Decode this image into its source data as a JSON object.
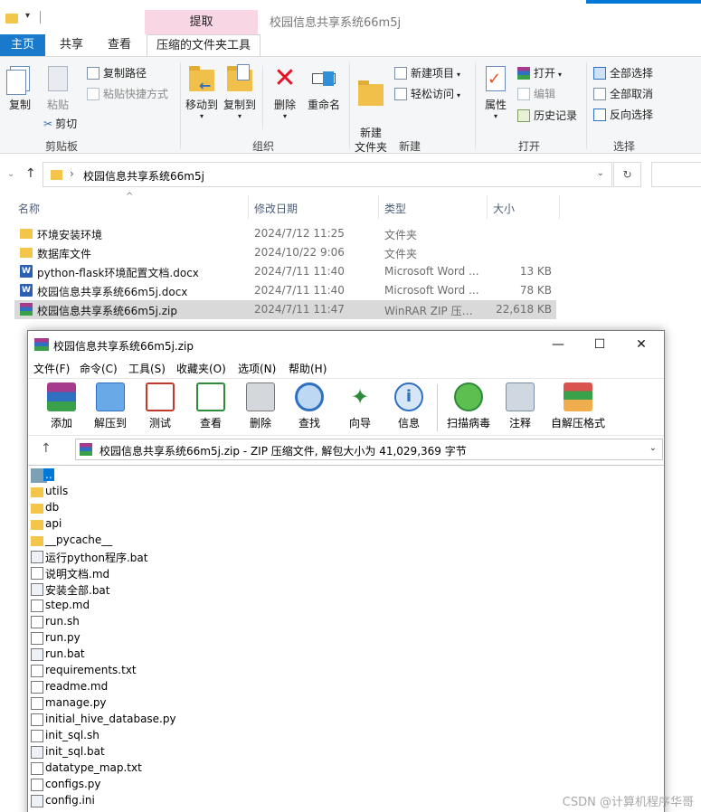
{
  "window": {
    "title": "校园信息共享系统66m5j",
    "context_tab": "提取"
  },
  "ribbon_tabs": [
    "主页",
    "共享",
    "查看",
    "压缩的文件夹工具"
  ],
  "ribbon": {
    "clipboard": {
      "copy": "复制",
      "paste": "粘贴",
      "copy_path": "复制路径",
      "paste_shortcut": "粘贴快捷方式",
      "cut": "剪切",
      "label": "剪贴板"
    },
    "organize": {
      "move_to": "移动到",
      "copy_to": "复制到",
      "delete": "删除",
      "rename": "重命名",
      "label": "组织"
    },
    "new": {
      "new_folder": "新建\n文件夹",
      "new_item": "新建项目",
      "easy_access": "轻松访问",
      "label": "新建"
    },
    "open": {
      "properties": "属性",
      "open": "打开",
      "edit": "编辑",
      "history": "历史记录",
      "label": "打开"
    },
    "select": {
      "select_all": "全部选择",
      "select_none": "全部取消",
      "invert": "反向选择",
      "label": "选择"
    }
  },
  "address": {
    "path": "校园信息共享系统66m5j"
  },
  "columns": {
    "name": "名称",
    "date": "修改日期",
    "type": "类型",
    "size": "大小"
  },
  "files": [
    {
      "name": "环境安装环境",
      "date": "2024/7/12 11:25",
      "type": "文件夹",
      "size": "",
      "icon": "folder"
    },
    {
      "name": "数据库文件",
      "date": "2024/10/22 9:06",
      "type": "文件夹",
      "size": "",
      "icon": "folder"
    },
    {
      "name": "python-flask环境配置文档.docx",
      "date": "2024/7/11 11:40",
      "type": "Microsoft Word ...",
      "size": "13 KB",
      "icon": "word"
    },
    {
      "name": "校园信息共享系统66m5j.docx",
      "date": "2024/7/11 11:40",
      "type": "Microsoft Word ...",
      "size": "78 KB",
      "icon": "word"
    },
    {
      "name": "校园信息共享系统66m5j.zip",
      "date": "2024/7/11 11:47",
      "type": "WinRAR ZIP 压缩...",
      "size": "22,618 KB",
      "icon": "rar",
      "selected": true
    }
  ],
  "winrar": {
    "title": "校园信息共享系统66m5j.zip",
    "menu": [
      "文件(F)",
      "命令(C)",
      "工具(S)",
      "收藏夹(O)",
      "选项(N)",
      "帮助(H)"
    ],
    "toolbar": [
      "添加",
      "解压到",
      "测试",
      "查看",
      "删除",
      "查找",
      "向导",
      "信息",
      "扫描病毒",
      "注释",
      "自解压格式"
    ],
    "path_text": "校园信息共享系统66m5j.zip - ZIP 压缩文件, 解包大小为 41,029,369 字节",
    "entries": [
      {
        "name": "..",
        "icon": "parent"
      },
      {
        "name": "utils",
        "icon": "folder"
      },
      {
        "name": "db",
        "icon": "folder"
      },
      {
        "name": "api",
        "icon": "folder"
      },
      {
        "name": "__pycache__",
        "icon": "folder"
      },
      {
        "name": "运行python程序.bat",
        "icon": "bat"
      },
      {
        "name": "说明文档.md",
        "icon": "file"
      },
      {
        "name": "安装全部.bat",
        "icon": "bat"
      },
      {
        "name": "step.md",
        "icon": "file"
      },
      {
        "name": "run.sh",
        "icon": "file"
      },
      {
        "name": "run.py",
        "icon": "file"
      },
      {
        "name": "run.bat",
        "icon": "bat"
      },
      {
        "name": "requirements.txt",
        "icon": "file"
      },
      {
        "name": "readme.md",
        "icon": "file"
      },
      {
        "name": "manage.py",
        "icon": "file"
      },
      {
        "name": "initial_hive_database.py",
        "icon": "file"
      },
      {
        "name": "init_sql.sh",
        "icon": "file"
      },
      {
        "name": "init_sql.bat",
        "icon": "bat"
      },
      {
        "name": "datatype_map.txt",
        "icon": "file"
      },
      {
        "name": "configs.py",
        "icon": "file"
      },
      {
        "name": "config.ini",
        "icon": "bat"
      }
    ]
  },
  "watermark": "CSDN @计算机程序华哥"
}
